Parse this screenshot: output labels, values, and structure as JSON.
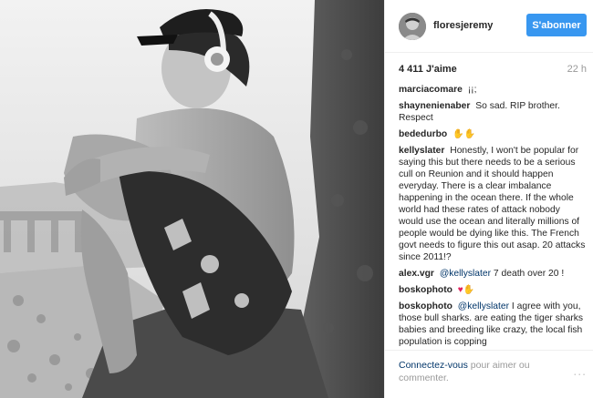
{
  "header": {
    "username": "floresjeremy",
    "follow_label": "S'abonner"
  },
  "stats": {
    "likes": "4 411 J'aime",
    "time": "22 h"
  },
  "comments": [
    {
      "user": "marciacomare",
      "text": "¡¡;"
    },
    {
      "user": "shaynenienaber",
      "text": "So sad. RIP brother. Respect"
    },
    {
      "user": "bededurbo",
      "text": "",
      "emoji": "raised-hands-icon"
    },
    {
      "user": "kellyslater",
      "text": "Honestly, I won't be popular for saying this but there needs to be a serious cull on Reunion and it should happen everyday. There is a clear imbalance happening in the ocean there. If the whole world had these rates of attack nobody would use the ocean and literally millions of people would be dying like this. The French govt needs to figure this out asap. 20 attacks since 2011!?"
    },
    {
      "user": "alex.vgr",
      "mention": "@kellyslater",
      "text": "7 death over 20 !"
    },
    {
      "user": "boskophoto",
      "text": "",
      "emoji": "heart-and-hands-icon"
    },
    {
      "user": "boskophoto",
      "mention": "@kellyslater",
      "text": "I agree with you, those bull sharks. are eating the tiger sharks babies and breeding like crazy, the local fish population is copping"
    }
  ],
  "footer": {
    "link_label": "Connectez-vous",
    "rest_label": "pour aimer ou commenter.",
    "more_label": "..."
  },
  "colors": {
    "accent": "#3897f0",
    "link": "#003569",
    "muted": "#999999"
  }
}
